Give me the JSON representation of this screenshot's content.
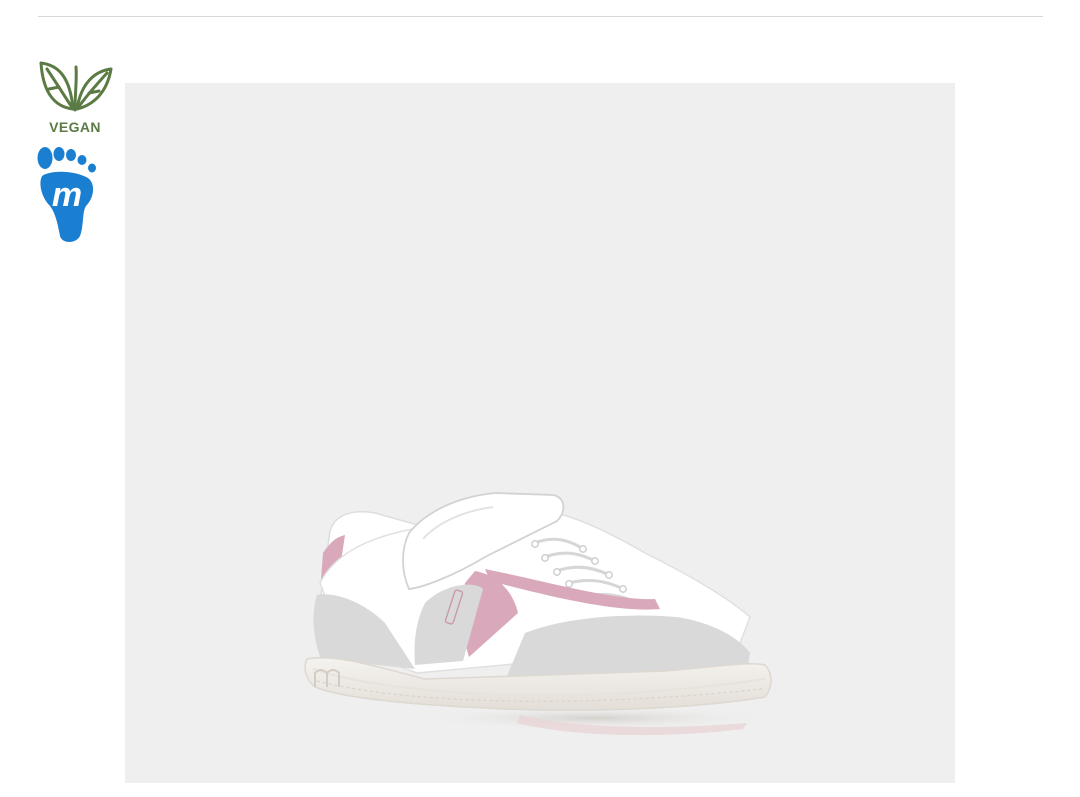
{
  "badges": {
    "vegan": {
      "icon": "leaf-icon",
      "label": "VEGAN",
      "color": "#5b7a44"
    },
    "brand_foot": {
      "icon": "foot-icon",
      "letter": "m",
      "color": "#1b7fd1"
    }
  },
  "product_image": {
    "subject": "shoe-image",
    "background": "#efefef",
    "colors": {
      "upper": "#ffffff",
      "suede": "#d9d9d9",
      "accent": "#d9a9bb",
      "sole": "#f2f0ec"
    }
  }
}
